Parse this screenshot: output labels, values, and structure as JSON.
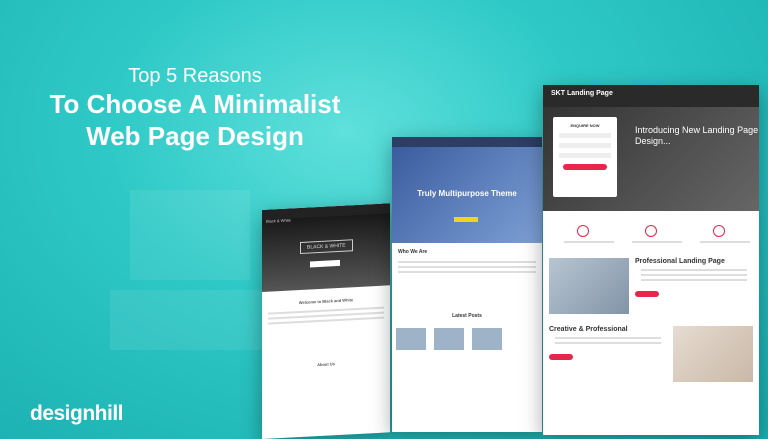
{
  "headline": {
    "line1": "Top 5 Reasons",
    "line2": "To Choose A Minimalist",
    "line3": "Web Page Design"
  },
  "logo": {
    "text": "designhill"
  },
  "mock1": {
    "brand": "Black & White",
    "hero_text": "BLACK & WHITE",
    "section": "Welcome to Black and White",
    "about": "About Us"
  },
  "mock2": {
    "hero_title": "Truly Multipurpose Theme",
    "who": "Who We Are",
    "latest": "Latest Posts"
  },
  "mock3": {
    "brand": "SKT Landing Page",
    "form_title": "ENQUIRE NOW",
    "intro": "Introducing New Landing Page Design...",
    "pro_title": "Professional Landing Page",
    "creative_title": "Creative & Professional"
  },
  "colors": {
    "accent": "#e8254b",
    "bg": "#2ec9c6"
  }
}
